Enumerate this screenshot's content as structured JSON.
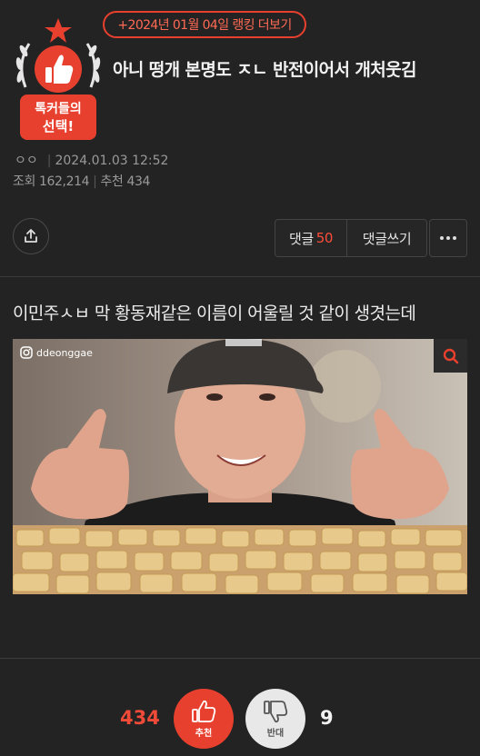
{
  "ranking_link": "+2024년 01월 04일 랭킹 더보기",
  "badge": {
    "line1": "톡커들의",
    "line2": "선택!"
  },
  "post": {
    "title": "아니 떵개 본명도 ㅈㄴ 반전이어서 개처웃김",
    "author": "ㅇㅇ",
    "date": "2024.01.03 12:52",
    "views_label": "조회",
    "views": "162,214",
    "recommend_label": "추천",
    "recommend": "434",
    "body": "이민주ㅅㅂ 막 황동재같은 이름이 어울릴 것 같이 생겻는데"
  },
  "actions": {
    "comments_label": "댓글",
    "comments_count": "50",
    "write_label": "댓글쓰기"
  },
  "image": {
    "watermark": "ddeonggae"
  },
  "votes": {
    "up_count": "434",
    "up_label": "추천",
    "down_label": "반대",
    "down_count": "9"
  },
  "colors": {
    "accent": "#e8402e",
    "background": "#232323"
  },
  "icons": [
    "star-icon",
    "thumbs-up-icon",
    "share-icon",
    "more-icon",
    "instagram-icon",
    "search-icon",
    "thumbs-down-icon"
  ]
}
